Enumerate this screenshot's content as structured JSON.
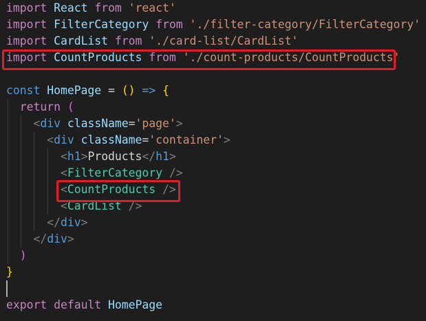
{
  "code_lines": [
    [
      {
        "t": "import",
        "c": "kw"
      },
      {
        "t": " ",
        "c": "punc"
      },
      {
        "t": "React",
        "c": "var"
      },
      {
        "t": " ",
        "c": "punc"
      },
      {
        "t": "from",
        "c": "kw"
      },
      {
        "t": " ",
        "c": "punc"
      },
      {
        "t": "'react'",
        "c": "str"
      }
    ],
    [
      {
        "t": "import",
        "c": "kw"
      },
      {
        "t": " ",
        "c": "punc"
      },
      {
        "t": "FilterCategory",
        "c": "var"
      },
      {
        "t": " ",
        "c": "punc"
      },
      {
        "t": "from",
        "c": "kw"
      },
      {
        "t": " ",
        "c": "punc"
      },
      {
        "t": "'./filter-category/FilterCategory'",
        "c": "str"
      }
    ],
    [
      {
        "t": "import",
        "c": "kw"
      },
      {
        "t": " ",
        "c": "punc"
      },
      {
        "t": "CardList",
        "c": "var"
      },
      {
        "t": " ",
        "c": "punc"
      },
      {
        "t": "from",
        "c": "kw"
      },
      {
        "t": " ",
        "c": "punc"
      },
      {
        "t": "'./card-list/CardList'",
        "c": "str"
      }
    ],
    [
      {
        "t": "import",
        "c": "kw"
      },
      {
        "t": " ",
        "c": "punc"
      },
      {
        "t": "CountProducts",
        "c": "var"
      },
      {
        "t": " ",
        "c": "punc"
      },
      {
        "t": "from",
        "c": "kw"
      },
      {
        "t": " ",
        "c": "punc"
      },
      {
        "t": "'./count-products/CountProducts'",
        "c": "str"
      }
    ],
    [],
    [
      {
        "t": "const",
        "c": "blue"
      },
      {
        "t": " ",
        "c": "punc"
      },
      {
        "t": "HomePage",
        "c": "var"
      },
      {
        "t": " = ",
        "c": "punc"
      },
      {
        "t": "()",
        "c": "b1"
      },
      {
        "t": " ",
        "c": "punc"
      },
      {
        "t": "=>",
        "c": "blue"
      },
      {
        "t": " ",
        "c": "punc"
      },
      {
        "t": "{",
        "c": "b1"
      }
    ],
    [
      {
        "t": "  ",
        "c": "punc"
      },
      {
        "t": "return",
        "c": "kw"
      },
      {
        "t": " ",
        "c": "punc"
      },
      {
        "t": "(",
        "c": "b2"
      }
    ],
    [
      {
        "t": "    ",
        "c": "punc"
      },
      {
        "t": "<",
        "c": "gray"
      },
      {
        "t": "div",
        "c": "tag"
      },
      {
        "t": " ",
        "c": "punc"
      },
      {
        "t": "className",
        "c": "var"
      },
      {
        "t": "=",
        "c": "punc"
      },
      {
        "t": "'page'",
        "c": "str"
      },
      {
        "t": ">",
        "c": "gray"
      }
    ],
    [
      {
        "t": "      ",
        "c": "punc"
      },
      {
        "t": "<",
        "c": "gray"
      },
      {
        "t": "div",
        "c": "tag"
      },
      {
        "t": " ",
        "c": "punc"
      },
      {
        "t": "className",
        "c": "var"
      },
      {
        "t": "=",
        "c": "punc"
      },
      {
        "t": "'container'",
        "c": "str"
      },
      {
        "t": ">",
        "c": "gray"
      }
    ],
    [
      {
        "t": "        ",
        "c": "punc"
      },
      {
        "t": "<",
        "c": "gray"
      },
      {
        "t": "h1",
        "c": "tag"
      },
      {
        "t": ">",
        "c": "gray"
      },
      {
        "t": "Products",
        "c": "punc"
      },
      {
        "t": "</",
        "c": "gray"
      },
      {
        "t": "h1",
        "c": "tag"
      },
      {
        "t": ">",
        "c": "gray"
      }
    ],
    [
      {
        "t": "        ",
        "c": "punc"
      },
      {
        "t": "<",
        "c": "gray"
      },
      {
        "t": "FilterCategory",
        "c": "jsxcmp"
      },
      {
        "t": " ",
        "c": "punc"
      },
      {
        "t": "/>",
        "c": "gray"
      }
    ],
    [
      {
        "t": "        ",
        "c": "punc"
      },
      {
        "t": "<",
        "c": "gray"
      },
      {
        "t": "CountProducts",
        "c": "jsxcmp"
      },
      {
        "t": " ",
        "c": "punc"
      },
      {
        "t": "/>",
        "c": "gray"
      }
    ],
    [
      {
        "t": "        ",
        "c": "punc"
      },
      {
        "t": "<",
        "c": "gray"
      },
      {
        "t": "CardList",
        "c": "jsxcmp"
      },
      {
        "t": " ",
        "c": "punc"
      },
      {
        "t": "/>",
        "c": "gray"
      }
    ],
    [
      {
        "t": "      ",
        "c": "punc"
      },
      {
        "t": "</",
        "c": "gray"
      },
      {
        "t": "div",
        "c": "tag"
      },
      {
        "t": ">",
        "c": "gray"
      }
    ],
    [
      {
        "t": "    ",
        "c": "punc"
      },
      {
        "t": "</",
        "c": "gray"
      },
      {
        "t": "div",
        "c": "tag"
      },
      {
        "t": ">",
        "c": "gray"
      }
    ],
    [
      {
        "t": "  ",
        "c": "punc"
      },
      {
        "t": ")",
        "c": "b2"
      }
    ],
    [
      {
        "t": "}",
        "c": "b1"
      }
    ],
    [],
    [
      {
        "t": "export",
        "c": "kw"
      },
      {
        "t": " ",
        "c": "punc"
      },
      {
        "t": "default",
        "c": "kw"
      },
      {
        "t": " ",
        "c": "punc"
      },
      {
        "t": "HomePage",
        "c": "var"
      }
    ]
  ],
  "colors": {
    "background": "#1e1e1e",
    "highlight_border": "#e11d2a"
  }
}
